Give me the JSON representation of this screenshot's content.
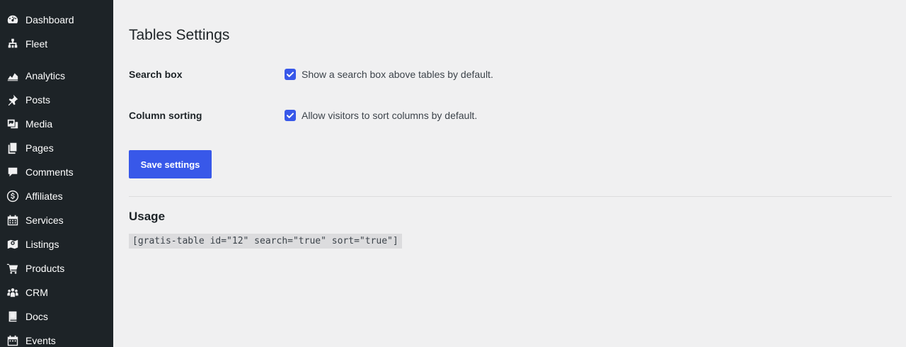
{
  "sidebar": {
    "items": [
      {
        "label": "Dashboard",
        "icon": "dashboard-icon"
      },
      {
        "label": "Fleet",
        "icon": "sitemap-icon"
      },
      {
        "label": "Analytics",
        "icon": "area-chart-icon"
      },
      {
        "label": "Posts",
        "icon": "pin-icon"
      },
      {
        "label": "Media",
        "icon": "media-icon"
      },
      {
        "label": "Pages",
        "icon": "pages-icon"
      },
      {
        "label": "Comments",
        "icon": "comment-icon"
      },
      {
        "label": "Affiliates",
        "icon": "dollar-icon"
      },
      {
        "label": "Services",
        "icon": "calendar-icon"
      },
      {
        "label": "Listings",
        "icon": "map-icon"
      },
      {
        "label": "Products",
        "icon": "cart-icon"
      },
      {
        "label": "CRM",
        "icon": "groups-icon"
      },
      {
        "label": "Docs",
        "icon": "book-icon"
      },
      {
        "label": "Events",
        "icon": "calendar-icon"
      }
    ]
  },
  "page": {
    "title": "Tables Settings",
    "settings": [
      {
        "label": "Search box",
        "description": "Show a search box above tables by default.",
        "checked": true
      },
      {
        "label": "Column sorting",
        "description": "Allow visitors to sort columns by default.",
        "checked": true
      }
    ],
    "save_label": "Save settings",
    "usage": {
      "title": "Usage",
      "shortcode": "[gratis-table id=\"12\" search=\"true\" sort=\"true\"]"
    }
  },
  "colors": {
    "sidebar_bg": "#1d2327",
    "accent": "#3858e9",
    "page_bg": "#f0f0f1"
  }
}
